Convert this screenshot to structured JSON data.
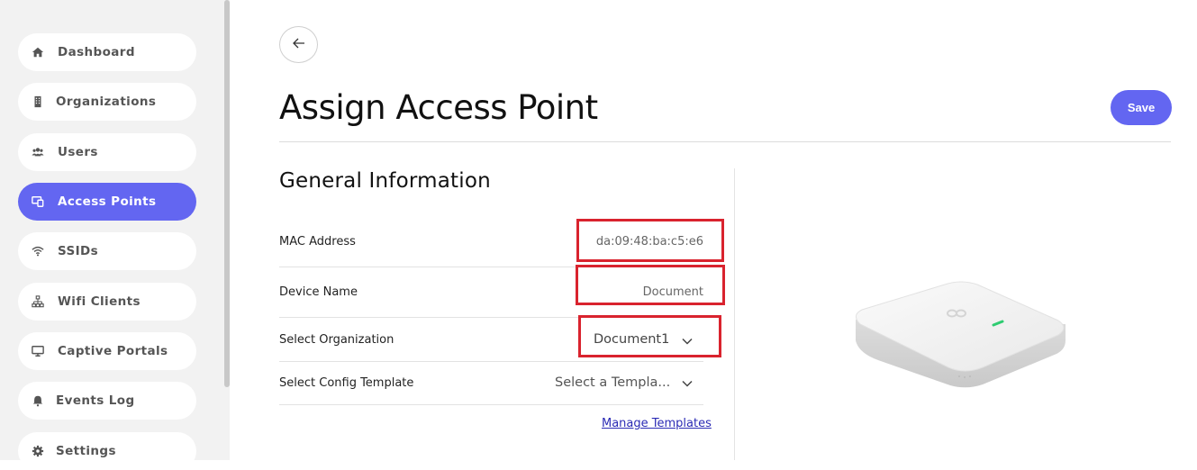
{
  "sidebar": {
    "items": [
      {
        "label": "Dashboard",
        "icon": "home-icon",
        "active": false
      },
      {
        "label": "Organizations",
        "icon": "building-icon",
        "active": false
      },
      {
        "label": "Users",
        "icon": "users-icon",
        "active": false
      },
      {
        "label": "Access Points",
        "icon": "access-points-icon",
        "active": true
      },
      {
        "label": "SSIDs",
        "icon": "wifi-icon",
        "active": false
      },
      {
        "label": "Wifi Clients",
        "icon": "network-icon",
        "active": false
      },
      {
        "label": "Captive Portals",
        "icon": "monitor-icon",
        "active": false
      },
      {
        "label": "Events Log",
        "icon": "bell-icon",
        "active": false
      },
      {
        "label": "Settings",
        "icon": "gear-icon",
        "active": false
      }
    ]
  },
  "header": {
    "title": "Assign Access Point",
    "save_label": "Save"
  },
  "form": {
    "section_title": "General Information",
    "mac_label": "MAC Address",
    "mac_value": "da:09:48:ba:c5:e6",
    "device_name_label": "Device Name",
    "device_name_value": "Document",
    "org_label": "Select Organization",
    "org_value": "Document1",
    "template_label": "Select Config Template",
    "template_placeholder": "Select a Templa...",
    "manage_templates_link": "Manage Templates"
  },
  "colors": {
    "accent": "#6366f1",
    "highlight": "#d9232e"
  }
}
